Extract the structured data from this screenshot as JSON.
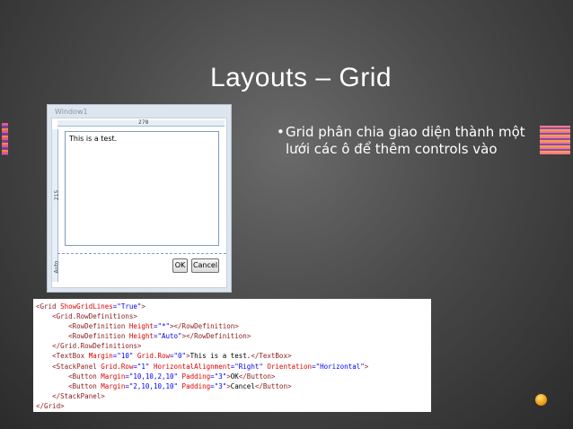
{
  "slide": {
    "title": "Layouts – Grid",
    "bullets": [
      "Grid phân chia giao diện thành một lưới các ô để thêm controls vào"
    ]
  },
  "window": {
    "title": "Window1",
    "ruler_top_value": "278",
    "ruler_left_value_1": "215",
    "ruler_left_value_2": "Auto",
    "textbox_text": "This is a test.",
    "ok_label": "OK",
    "cancel_label": "Cancel"
  },
  "code": {
    "lines": [
      [
        {
          "c": "t",
          "s": "<Grid "
        },
        {
          "c": "a",
          "s": "ShowGridLines"
        },
        {
          "c": "v",
          "s": "=\"True\""
        },
        {
          "c": "t",
          "s": ">"
        }
      ],
      [
        {
          "c": "",
          "s": "    "
        },
        {
          "c": "t",
          "s": "<Grid.RowDefinitions>"
        }
      ],
      [
        {
          "c": "",
          "s": "        "
        },
        {
          "c": "t",
          "s": "<RowDefinition "
        },
        {
          "c": "a",
          "s": "Height"
        },
        {
          "c": "v",
          "s": "=\"*\""
        },
        {
          "c": "t",
          "s": "></RowDefinition>"
        }
      ],
      [
        {
          "c": "",
          "s": "        "
        },
        {
          "c": "t",
          "s": "<RowDefinition "
        },
        {
          "c": "a",
          "s": "Height"
        },
        {
          "c": "v",
          "s": "=\"Auto\""
        },
        {
          "c": "t",
          "s": "></RowDefinition>"
        }
      ],
      [
        {
          "c": "",
          "s": "    "
        },
        {
          "c": "t",
          "s": "</Grid.RowDefinitions>"
        }
      ],
      [
        {
          "c": "",
          "s": "    "
        },
        {
          "c": "t",
          "s": "<TextBox "
        },
        {
          "c": "a",
          "s": "Margin"
        },
        {
          "c": "v",
          "s": "=\"10\""
        },
        {
          "c": "a",
          "s": " Grid.Row"
        },
        {
          "c": "v",
          "s": "=\"0\""
        },
        {
          "c": "t",
          "s": ">"
        },
        {
          "c": "",
          "s": "This is a test."
        },
        {
          "c": "t",
          "s": "</TextBox>"
        }
      ],
      [
        {
          "c": "",
          "s": "    "
        },
        {
          "c": "t",
          "s": "<StackPanel "
        },
        {
          "c": "a",
          "s": "Grid.Row"
        },
        {
          "c": "v",
          "s": "=\"1\""
        },
        {
          "c": "a",
          "s": " HorizontalAlignment"
        },
        {
          "c": "v",
          "s": "=\"Right\""
        },
        {
          "c": "a",
          "s": " Orientation"
        },
        {
          "c": "v",
          "s": "=\"Horizontal\""
        },
        {
          "c": "t",
          "s": ">"
        }
      ],
      [
        {
          "c": "",
          "s": "        "
        },
        {
          "c": "t",
          "s": "<Button "
        },
        {
          "c": "a",
          "s": "Margin"
        },
        {
          "c": "v",
          "s": "=\"10,10,2,10\""
        },
        {
          "c": "a",
          "s": " Padding"
        },
        {
          "c": "v",
          "s": "=\"3\""
        },
        {
          "c": "t",
          "s": ">"
        },
        {
          "c": "",
          "s": "OK"
        },
        {
          "c": "t",
          "s": "</Button>"
        }
      ],
      [
        {
          "c": "",
          "s": "        "
        },
        {
          "c": "t",
          "s": "<Button "
        },
        {
          "c": "a",
          "s": "Margin"
        },
        {
          "c": "v",
          "s": "=\"2,10,10,10\""
        },
        {
          "c": "a",
          "s": " Padding"
        },
        {
          "c": "v",
          "s": "=\"3\""
        },
        {
          "c": "t",
          "s": ">"
        },
        {
          "c": "",
          "s": "Cancel"
        },
        {
          "c": "t",
          "s": "</Button>"
        }
      ],
      [
        {
          "c": "",
          "s": "    "
        },
        {
          "c": "t",
          "s": "</StackPanel>"
        }
      ],
      [
        {
          "c": "t",
          "s": "</Grid>"
        }
      ]
    ]
  }
}
